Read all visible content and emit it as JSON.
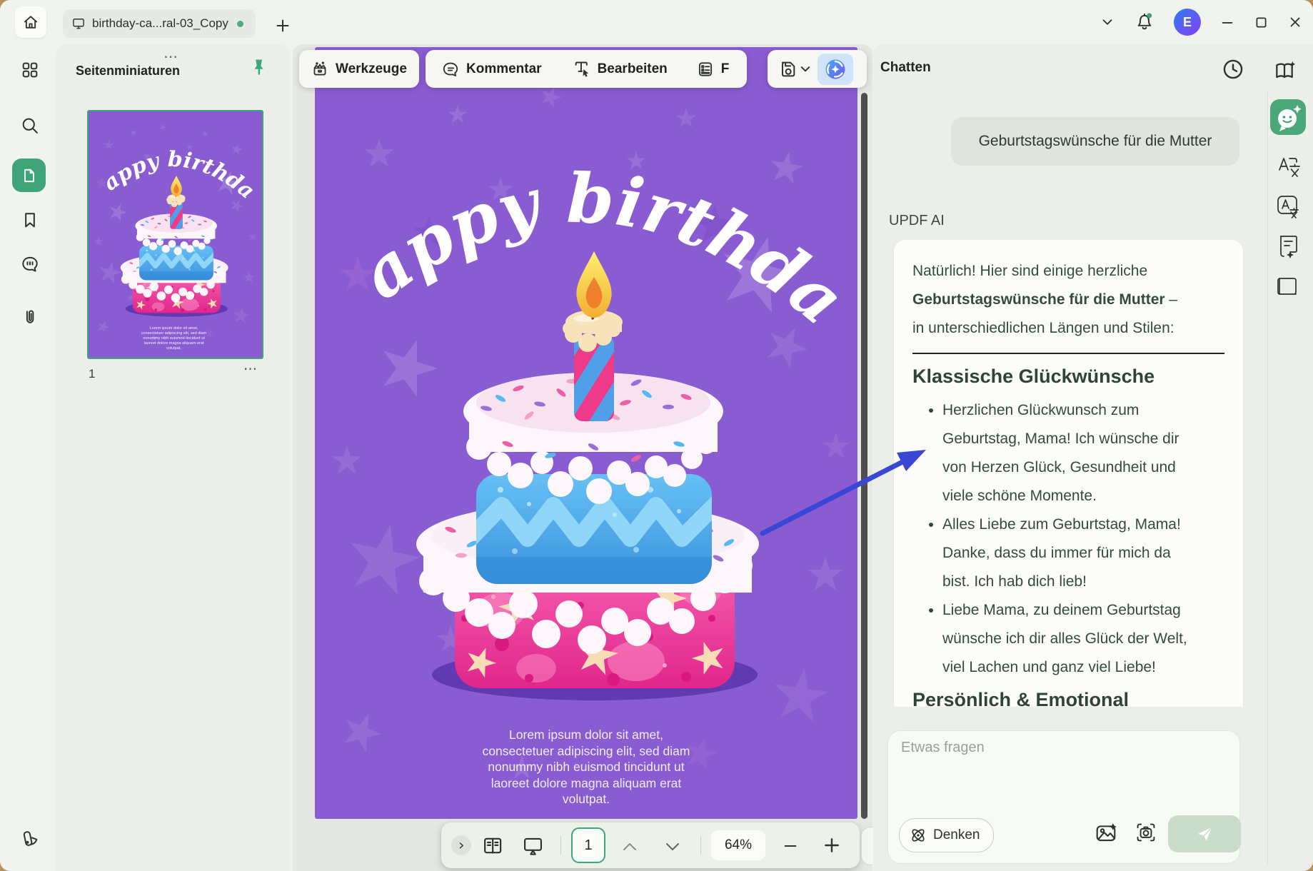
{
  "app": {
    "tab_title": "birthday-ca...ral-03_Copy",
    "avatar_initial": "E"
  },
  "icon_names": [
    "home-icon",
    "monitor-icon",
    "add-tab-icon",
    "dropdown-chevron-icon",
    "notification-bell-icon",
    "minimize-icon",
    "maximize-icon",
    "close-icon",
    "grid-icon",
    "search-icon",
    "page-thumbnails-icon",
    "bookmark-icon",
    "comment-icon",
    "attachment-icon",
    "swatches-icon",
    "drag-handle-icon",
    "pin-icon",
    "tools-icon",
    "comment-bubble-icon",
    "edit-text-icon",
    "form-icon",
    "save-icon",
    "save-chevron-icon",
    "updf-ai-icon",
    "history-icon",
    "ai-book-icon",
    "ai-chat-icon",
    "translate-icon",
    "translate-box-icon",
    "summarize-icon",
    "book-icon",
    "expand-icon",
    "reader-view-icon",
    "presentation-icon",
    "page-up-icon",
    "page-down-icon",
    "zoom-out-icon",
    "zoom-in-icon",
    "atom-icon",
    "image-sparkle-icon",
    "screenshot-icon",
    "send-icon",
    "more-dots-icon"
  ],
  "colors": {
    "accent_green": "#3ca877",
    "card_purple": "#8a5cd2",
    "arrow_blue": "#3a46d4",
    "ai_gradient_start": "#41b0fa",
    "ai_gradient_end": "#6e55ef"
  },
  "thumbnails_panel": {
    "title": "Seitenminiaturen",
    "page_label": "1",
    "more": "⋯",
    "handle": "⋯"
  },
  "toolbar": {
    "tools": "Werkzeuge",
    "comment": "Kommentar",
    "edit": "Bearbeiten",
    "form_partial": "F"
  },
  "document": {
    "script_title": "Happy birthday",
    "lorem": "Lorem ipsum dolor sit amet,\nconsectetuer adipiscing elit, sed diam\nnonummy nibh euismod tincidunt ut\nlaoreet dolore magna aliquam erat\nvolutpat."
  },
  "statusbar": {
    "page": "1",
    "zoom": "64%"
  },
  "chat": {
    "header": "Chatten",
    "user_message": "Geburtstagswünsche für die Mutter",
    "ai_label": "UPDF AI",
    "intro_line1": "Natürlich! Hier sind einige herzliche",
    "intro_bold": "Geburtstagswünsche für die Mutter",
    "intro_dash": " –",
    "intro_line2": "in unterschiedlichen Längen und Stilen:",
    "section1_title": "Klassische Glückwünsche",
    "bullets": [
      "Herzlichen Glückwunsch zum\nGeburtstag, Mama! Ich wünsche dir\nvon Herzen Glück, Gesundheit und\nviele schöne Momente.",
      "Alles Liebe zum Geburtstag, Mama!\nDanke, dass du immer für mich da\nbist. Ich hab dich lieb!",
      "Liebe Mama, zu deinem Geburtstag\nwünsche ich dir alles Glück der Welt,\nviel Lachen und ganz viel Liebe!"
    ],
    "section2_title": "Persönlich & Emotional",
    "input_placeholder": "Etwas fragen",
    "think_button": "Denken"
  }
}
